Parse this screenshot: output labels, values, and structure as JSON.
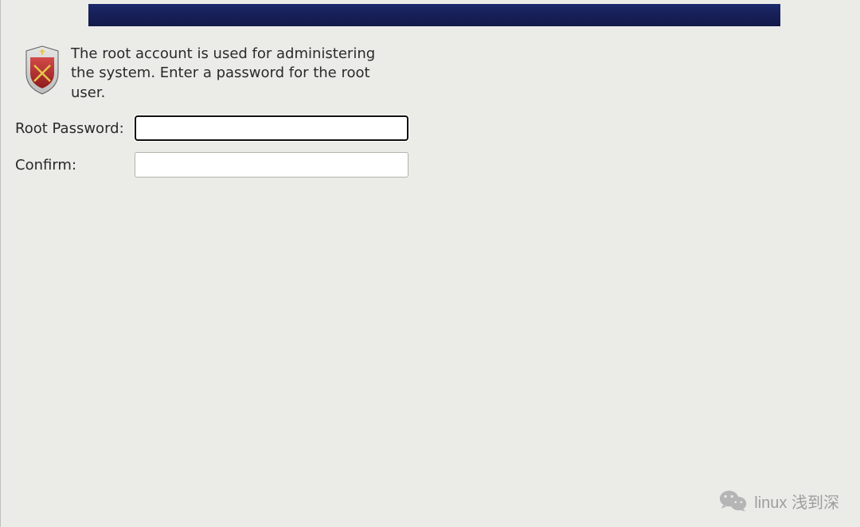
{
  "description": "The root account is used for administering the system.  Enter a password for the root user.",
  "form": {
    "root_password_label": "Root Password:",
    "root_password_value": "",
    "confirm_label": "Confirm:",
    "confirm_value": ""
  },
  "watermark": {
    "text": "linux 浅到深"
  }
}
